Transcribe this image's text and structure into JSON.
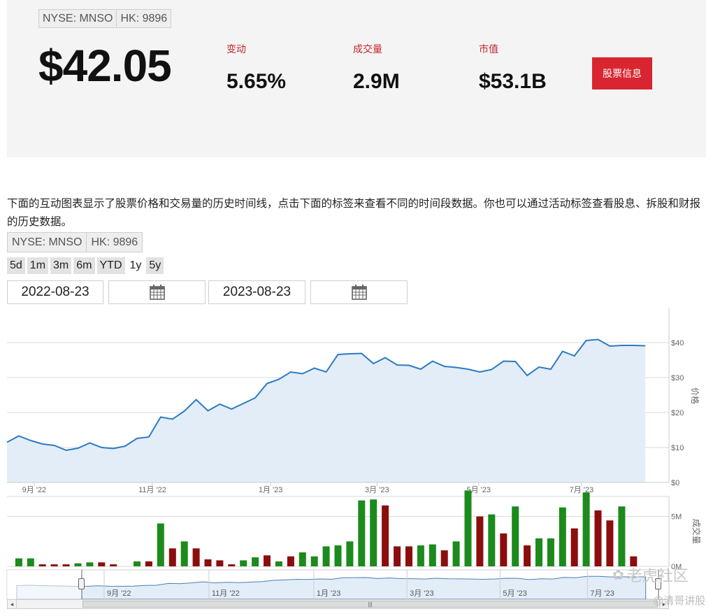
{
  "header": {
    "tickers": [
      "NYSE: MNSO",
      "HK: 9896"
    ],
    "price": "$42.05",
    "stats": [
      {
        "label": "变动",
        "value": "5.65%"
      },
      {
        "label": "成交量",
        "value": "2.9M"
      },
      {
        "label": "市值",
        "value": "$53.1B"
      }
    ],
    "info_button": "股票信息"
  },
  "description": "下面的互动图表显示了股票价格和交易量的历史时间线，点击下面的标签来查看不同的时间段数据。你也可以通过活动标签查看股息、拆股和财报的历史数据。",
  "chart_controls": {
    "tickers": [
      "NYSE: MNSO",
      "HK: 9896"
    ],
    "ranges": [
      "5d",
      "1m",
      "3m",
      "6m",
      "YTD",
      "1y",
      "5y"
    ],
    "active_range": "1y",
    "start_date": "2022-08-23",
    "end_date": "2023-08-23",
    "calendar_icon": "calendar-icon"
  },
  "watermark": {
    "brand": "老虎社区",
    "author": "@清哥讲股"
  },
  "colors": {
    "line": "#2b7bc4",
    "area": "#e3edf8",
    "vol_up": "#1c8a1c",
    "vol_down": "#8b0d0d",
    "accent": "#d9252f"
  },
  "chart_data": [
    {
      "type": "area",
      "ylabel": "价格",
      "ylim": [
        0,
        50
      ],
      "y_ticks": [
        "$0",
        "$10",
        "$20",
        "$30",
        "$40"
      ],
      "x_ticks": [
        {
          "label": "9月 '22",
          "x": 2.3
        },
        {
          "label": "11月 '22",
          "x": 12.3
        },
        {
          "label": "1月 '23",
          "x": 22.3
        },
        {
          "label": "3月 '23",
          "x": 31.3
        },
        {
          "label": "5月 '23",
          "x": 39.9
        },
        {
          "label": "7月 '23",
          "x": 48.6
        }
      ],
      "x_range": [
        0,
        56
      ],
      "series": [
        {
          "x": [
            0,
            1,
            2,
            3,
            4,
            5,
            6,
            7,
            8,
            9,
            10,
            11,
            12,
            13,
            14,
            15,
            16,
            17,
            18,
            19,
            20,
            21,
            22,
            23,
            24,
            25,
            26,
            27,
            28,
            29,
            30,
            31,
            32,
            33,
            34,
            35,
            36,
            37,
            38,
            39,
            40,
            41,
            42,
            43,
            44,
            45,
            46,
            47,
            48,
            49,
            50,
            51,
            52,
            53,
            54
          ],
          "values": [
            11.5,
            13.3,
            12,
            11,
            10.6,
            9.2,
            9.8,
            11.3,
            10,
            9.7,
            10.4,
            12.6,
            13,
            18.7,
            18.1,
            20.4,
            23.7,
            20.5,
            22.4,
            21,
            22.6,
            24.2,
            28.3,
            29.5,
            31.6,
            31.1,
            32.7,
            31.6,
            36.6,
            36.8,
            36.9,
            34,
            35.7,
            33.6,
            33.5,
            32.4,
            34.7,
            33.2,
            32.9,
            32.4,
            31.6,
            32.3,
            34.7,
            34.6,
            30.6,
            33,
            32.4,
            37.5,
            36.2,
            40.6,
            40.9,
            39,
            39.2,
            39.2,
            39.1
          ]
        }
      ]
    },
    {
      "type": "bar",
      "ylabel": "成交量",
      "ylim": [
        0,
        7
      ],
      "y_ticks": [
        "0M",
        "5M"
      ],
      "x_range": [
        0,
        56
      ],
      "x": [
        1,
        2,
        3,
        4,
        5,
        6,
        7,
        8,
        9,
        11,
        12,
        13,
        14,
        15,
        16,
        17,
        18,
        19,
        20,
        21,
        22,
        23,
        24,
        25,
        26,
        27,
        28,
        29,
        30,
        31,
        32,
        33,
        34,
        35,
        36,
        37,
        38,
        39,
        40,
        41,
        42,
        43,
        44,
        45,
        46,
        47,
        48,
        49,
        50,
        51,
        52,
        53,
        54,
        55
      ],
      "values": [
        0.8,
        0.8,
        0.2,
        0.2,
        0.2,
        0.3,
        0.4,
        0.4,
        0.2,
        0.5,
        0.5,
        4.3,
        1.8,
        2.5,
        1.8,
        0.7,
        0.6,
        0.2,
        0.6,
        0.9,
        1.1,
        0.5,
        1,
        1.4,
        1,
        2,
        2.1,
        2.5,
        6.6,
        6.7,
        6.1,
        2,
        2,
        2.1,
        2.2,
        1.6,
        2.5,
        7.6,
        5,
        5.2,
        3.3,
        6,
        2.1,
        2.8,
        2.8,
        5.9,
        3.8,
        7.4,
        5.6,
        4.6,
        6,
        1
      ],
      "direction": [
        "up",
        "up",
        "down",
        "down",
        "down",
        "up",
        "up",
        "down",
        "down",
        "up",
        "down",
        "up",
        "down",
        "up",
        "down",
        "down",
        "down",
        "down",
        "up",
        "up",
        "down",
        "up",
        "down",
        "up",
        "up",
        "up",
        "up",
        "up",
        "up",
        "up",
        "down",
        "down",
        "down",
        "up",
        "up",
        "down",
        "up",
        "up",
        "down",
        "up",
        "down",
        "up",
        "down",
        "up",
        "up",
        "up",
        "down",
        "up",
        "down",
        "down",
        "up",
        "down"
      ]
    }
  ],
  "navigator": {
    "x_ticks": [
      "9月 '22",
      "11月 '22",
      "1月 '23",
      "3月 '23",
      "5月 '23",
      "7月 '23"
    ]
  }
}
